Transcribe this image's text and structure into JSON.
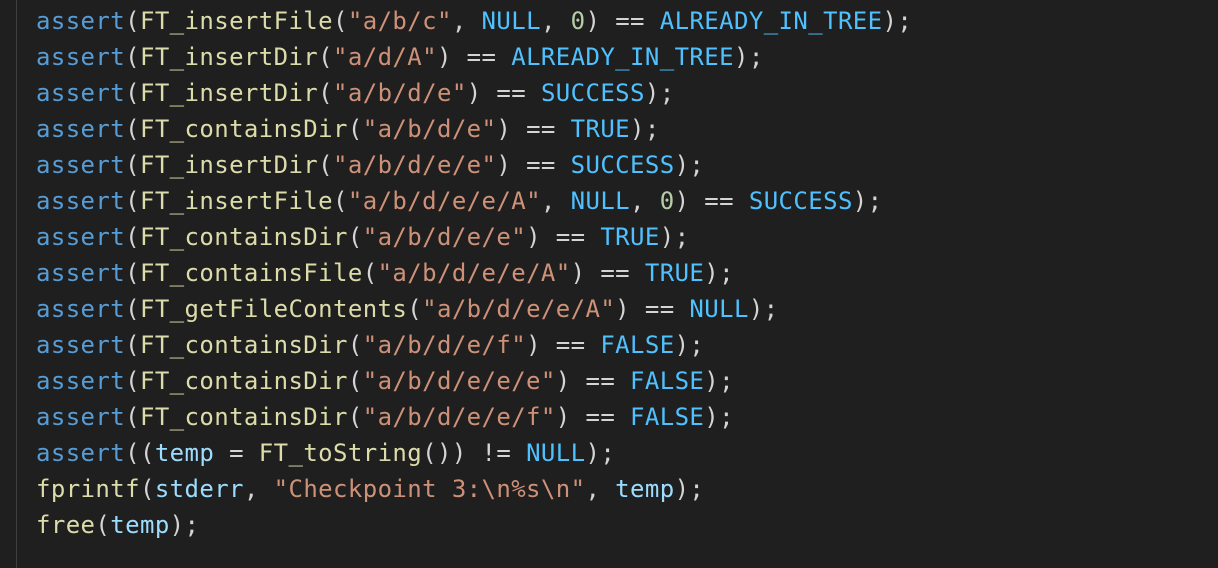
{
  "editor": {
    "colors": {
      "background": "#1f1f1f",
      "function": "#dcdcaa",
      "system_function": "#569cd6",
      "string": "#ce9178",
      "number": "#b5cea8",
      "constant": "#4fc1ff",
      "variable": "#9cdcfe",
      "punctuation": "#d4d4d4"
    },
    "lines": [
      [
        [
          "sys",
          "assert"
        ],
        [
          "p",
          "("
        ],
        [
          "fn",
          "FT_insertFile"
        ],
        [
          "p",
          "("
        ],
        [
          "str",
          "\"a/b/c\""
        ],
        [
          "p",
          ", "
        ],
        [
          "const",
          "NULL"
        ],
        [
          "p",
          ", "
        ],
        [
          "num",
          "0"
        ],
        [
          "p",
          ") == "
        ],
        [
          "const",
          "ALREADY_IN_TREE"
        ],
        [
          "p",
          ");"
        ]
      ],
      [
        [
          "sys",
          "assert"
        ],
        [
          "p",
          "("
        ],
        [
          "fn",
          "FT_insertDir"
        ],
        [
          "p",
          "("
        ],
        [
          "str",
          "\"a/d/A\""
        ],
        [
          "p",
          ") == "
        ],
        [
          "const",
          "ALREADY_IN_TREE"
        ],
        [
          "p",
          ");"
        ]
      ],
      [
        [
          "sys",
          "assert"
        ],
        [
          "p",
          "("
        ],
        [
          "fn",
          "FT_insertDir"
        ],
        [
          "p",
          "("
        ],
        [
          "str",
          "\"a/b/d/e\""
        ],
        [
          "p",
          ") == "
        ],
        [
          "const",
          "SUCCESS"
        ],
        [
          "p",
          ");"
        ]
      ],
      [
        [
          "sys",
          "assert"
        ],
        [
          "p",
          "("
        ],
        [
          "fn",
          "FT_containsDir"
        ],
        [
          "p",
          "("
        ],
        [
          "str",
          "\"a/b/d/e\""
        ],
        [
          "p",
          ") == "
        ],
        [
          "const",
          "TRUE"
        ],
        [
          "p",
          ");"
        ]
      ],
      [
        [
          "sys",
          "assert"
        ],
        [
          "p",
          "("
        ],
        [
          "fn",
          "FT_insertDir"
        ],
        [
          "p",
          "("
        ],
        [
          "str",
          "\"a/b/d/e/e\""
        ],
        [
          "p",
          ") == "
        ],
        [
          "const",
          "SUCCESS"
        ],
        [
          "p",
          ");"
        ]
      ],
      [
        [
          "sys",
          "assert"
        ],
        [
          "p",
          "("
        ],
        [
          "fn",
          "FT_insertFile"
        ],
        [
          "p",
          "("
        ],
        [
          "str",
          "\"a/b/d/e/e/A\""
        ],
        [
          "p",
          ", "
        ],
        [
          "const",
          "NULL"
        ],
        [
          "p",
          ", "
        ],
        [
          "num",
          "0"
        ],
        [
          "p",
          ") == "
        ],
        [
          "const",
          "SUCCESS"
        ],
        [
          "p",
          ");"
        ]
      ],
      [
        [
          "sys",
          "assert"
        ],
        [
          "p",
          "("
        ],
        [
          "fn",
          "FT_containsDir"
        ],
        [
          "p",
          "("
        ],
        [
          "str",
          "\"a/b/d/e/e\""
        ],
        [
          "p",
          ") == "
        ],
        [
          "const",
          "TRUE"
        ],
        [
          "p",
          ");"
        ]
      ],
      [
        [
          "sys",
          "assert"
        ],
        [
          "p",
          "("
        ],
        [
          "fn",
          "FT_containsFile"
        ],
        [
          "p",
          "("
        ],
        [
          "str",
          "\"a/b/d/e/e/A\""
        ],
        [
          "p",
          ") == "
        ],
        [
          "const",
          "TRUE"
        ],
        [
          "p",
          ");"
        ]
      ],
      [
        [
          "sys",
          "assert"
        ],
        [
          "p",
          "("
        ],
        [
          "fn",
          "FT_getFileContents"
        ],
        [
          "p",
          "("
        ],
        [
          "str",
          "\"a/b/d/e/e/A\""
        ],
        [
          "p",
          ") == "
        ],
        [
          "const",
          "NULL"
        ],
        [
          "p",
          ");"
        ]
      ],
      [
        [
          "sys",
          "assert"
        ],
        [
          "p",
          "("
        ],
        [
          "fn",
          "FT_containsDir"
        ],
        [
          "p",
          "("
        ],
        [
          "str",
          "\"a/b/d/e/f\""
        ],
        [
          "p",
          ") == "
        ],
        [
          "const",
          "FALSE"
        ],
        [
          "p",
          ");"
        ]
      ],
      [
        [
          "sys",
          "assert"
        ],
        [
          "p",
          "("
        ],
        [
          "fn",
          "FT_containsDir"
        ],
        [
          "p",
          "("
        ],
        [
          "str",
          "\"a/b/d/e/e/e\""
        ],
        [
          "p",
          ") == "
        ],
        [
          "const",
          "FALSE"
        ],
        [
          "p",
          ");"
        ]
      ],
      [
        [
          "sys",
          "assert"
        ],
        [
          "p",
          "("
        ],
        [
          "fn",
          "FT_containsDir"
        ],
        [
          "p",
          "("
        ],
        [
          "str",
          "\"a/b/d/e/e/f\""
        ],
        [
          "p",
          ") == "
        ],
        [
          "const",
          "FALSE"
        ],
        [
          "p",
          ");"
        ]
      ],
      [
        [
          "sys",
          "assert"
        ],
        [
          "p",
          "(("
        ],
        [
          "var",
          "temp"
        ],
        [
          "p",
          " = "
        ],
        [
          "fn",
          "FT_toString"
        ],
        [
          "p",
          "()) != "
        ],
        [
          "const",
          "NULL"
        ],
        [
          "p",
          ");"
        ]
      ],
      [
        [
          "fn",
          "fprintf"
        ],
        [
          "p",
          "("
        ],
        [
          "var",
          "stderr"
        ],
        [
          "p",
          ", "
        ],
        [
          "str",
          "\"Checkpoint 3:\\n%s\\n\""
        ],
        [
          "p",
          ", "
        ],
        [
          "var",
          "temp"
        ],
        [
          "p",
          ");"
        ]
      ],
      [
        [
          "fn",
          "free"
        ],
        [
          "p",
          "("
        ],
        [
          "var",
          "temp"
        ],
        [
          "p",
          ");"
        ]
      ]
    ]
  }
}
